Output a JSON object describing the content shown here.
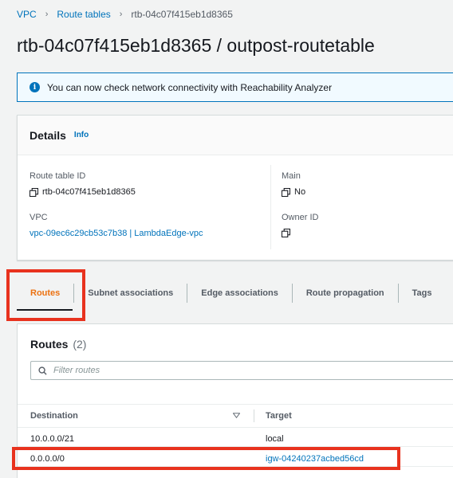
{
  "breadcrumb": {
    "items": [
      "VPC",
      "Route tables"
    ],
    "current": "rtb-04c07f415eb1d8365",
    "separator": "›"
  },
  "page_title": "rtb-04c07f415eb1d8365 / outpost-routetable",
  "flash": {
    "icon": "info-icon",
    "message": "You can now check network connectivity with Reachability Analyzer"
  },
  "details": {
    "title": "Details",
    "info_link": "Info",
    "route_table_id": {
      "label": "Route table ID",
      "value": "rtb-04c07f415eb1d8365"
    },
    "main": {
      "label": "Main",
      "value": "No"
    },
    "vpc": {
      "label": "VPC",
      "value": "vpc-09ec6c29cb53c7b38 | LambdaEdge-vpc"
    },
    "owner_id": {
      "label": "Owner ID",
      "value": ""
    }
  },
  "tabs": [
    {
      "label": "Routes",
      "active": true
    },
    {
      "label": "Subnet associations",
      "active": false
    },
    {
      "label": "Edge associations",
      "active": false
    },
    {
      "label": "Route propagation",
      "active": false
    },
    {
      "label": "Tags",
      "active": false
    }
  ],
  "routes": {
    "title": "Routes",
    "count": "(2)",
    "filter_placeholder": "Filter routes",
    "columns": [
      "Destination",
      "Target"
    ],
    "rows": [
      {
        "destination": "10.0.0.0/21",
        "target": "local",
        "target_is_link": false
      },
      {
        "destination": "0.0.0.0/0",
        "target": "igw-04240237acbed56cd",
        "target_is_link": true
      }
    ]
  },
  "colors": {
    "link": "#0073bb",
    "active_tab": "#ec7211",
    "highlight": "#e8321e",
    "flash_bg": "#f1faff"
  }
}
